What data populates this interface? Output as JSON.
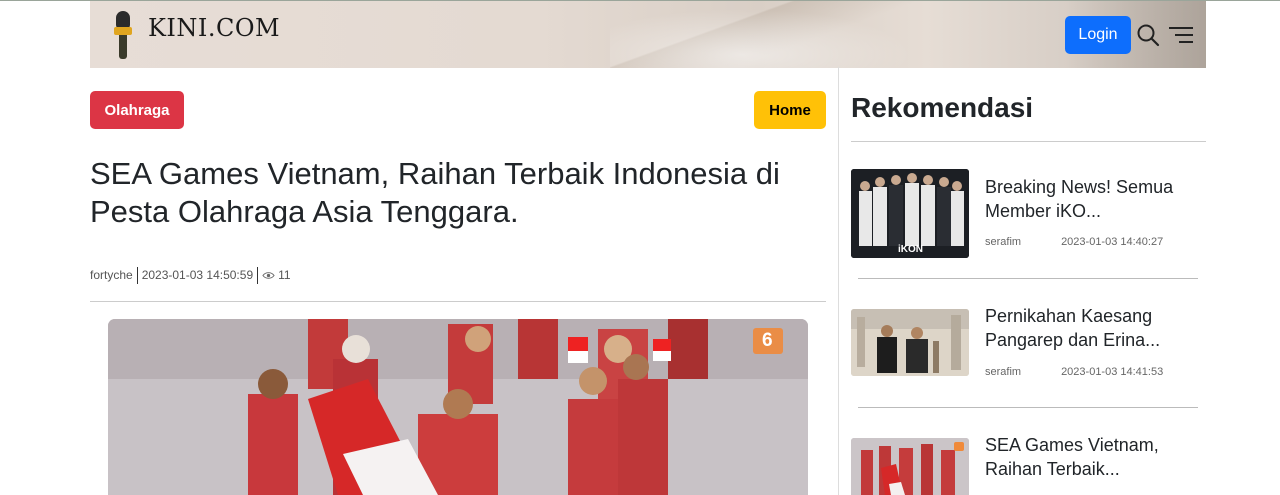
{
  "header": {
    "logo_text": "KINI.COM",
    "login_label": "Login",
    "icons": [
      "microphone-logo-icon",
      "search-icon",
      "menu-icon"
    ]
  },
  "article": {
    "category": "Olahraga",
    "home_label": "Home",
    "title": "SEA Games Vietnam, Raihan Terbaik Indonesia di Pesta Olahraga Asia Tenggara.",
    "author": "fortyche",
    "datetime": "2023-01-03 14:50:59",
    "views": "11",
    "image_badge": "6"
  },
  "sidebar": {
    "heading": "Rekomendasi",
    "items": [
      {
        "title": "Breaking News! Semua Member iKO...",
        "author": "serafim",
        "datetime": "2023-01-03 14:40:27",
        "thumb_caption": "iKON"
      },
      {
        "title": "Pernikahan Kaesang Pangarep dan Erina...",
        "author": "serafim",
        "datetime": "2023-01-03 14:41:53"
      },
      {
        "title": "SEA Games Vietnam, Raihan Terbaik..."
      }
    ]
  },
  "colors": {
    "login": "#0d6efd",
    "category_badge": "#dc3545",
    "home_badge": "#ffc107"
  }
}
